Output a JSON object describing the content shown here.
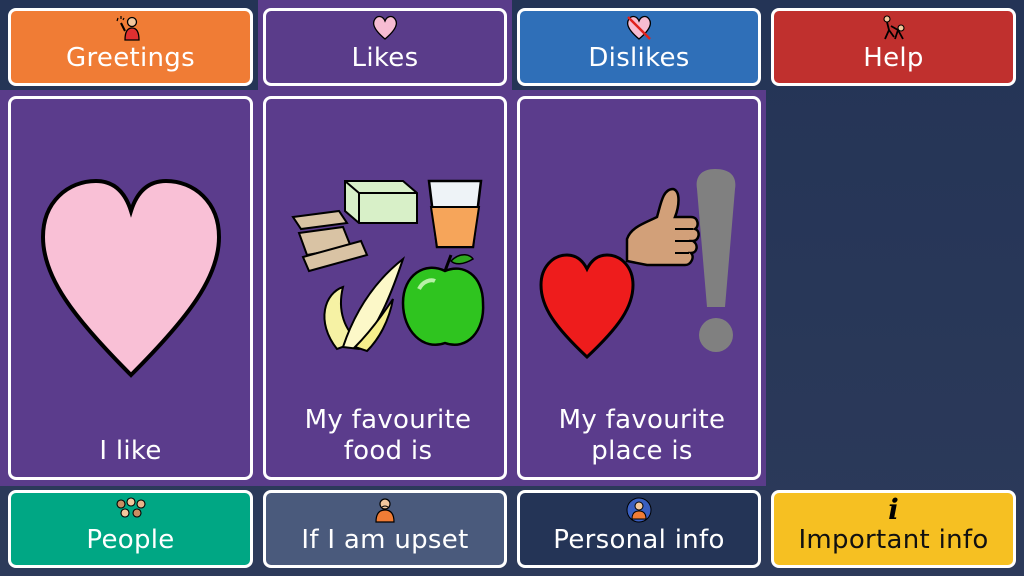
{
  "colors": {
    "background": "#2a3856",
    "greetings": "#f07c35",
    "likes": "#5a3c8a",
    "dislikes": "#2f6fb8",
    "help": "#c0302e",
    "card_purple": "#5b3c8c",
    "people": "#00a784",
    "upset": "#4a5a7c",
    "personal": "#243456",
    "important": "#f6c022"
  },
  "top_row": [
    {
      "label": "Greetings",
      "icon": "waving-person-icon"
    },
    {
      "label": "Likes",
      "icon": "heart-icon"
    },
    {
      "label": "Dislikes",
      "icon": "crossed-heart-icon"
    },
    {
      "label": "Help",
      "icon": "helping-person-icon"
    }
  ],
  "cards": [
    {
      "label": "I like",
      "icon": "pink-heart-icon"
    },
    {
      "label": "My favourite food is",
      "icon": "food-icon"
    },
    {
      "label": "My favourite place is",
      "icon": "heart-thumbs-up-exclamation-icon"
    }
  ],
  "bottom_row": [
    {
      "label": "People",
      "icon": "group-of-people-icon"
    },
    {
      "label": "If I am upset",
      "icon": "upset-person-icon"
    },
    {
      "label": "Personal info",
      "icon": "personal-info-icon"
    },
    {
      "label": "Important info",
      "icon": "info-icon",
      "icon_text": "i"
    }
  ]
}
